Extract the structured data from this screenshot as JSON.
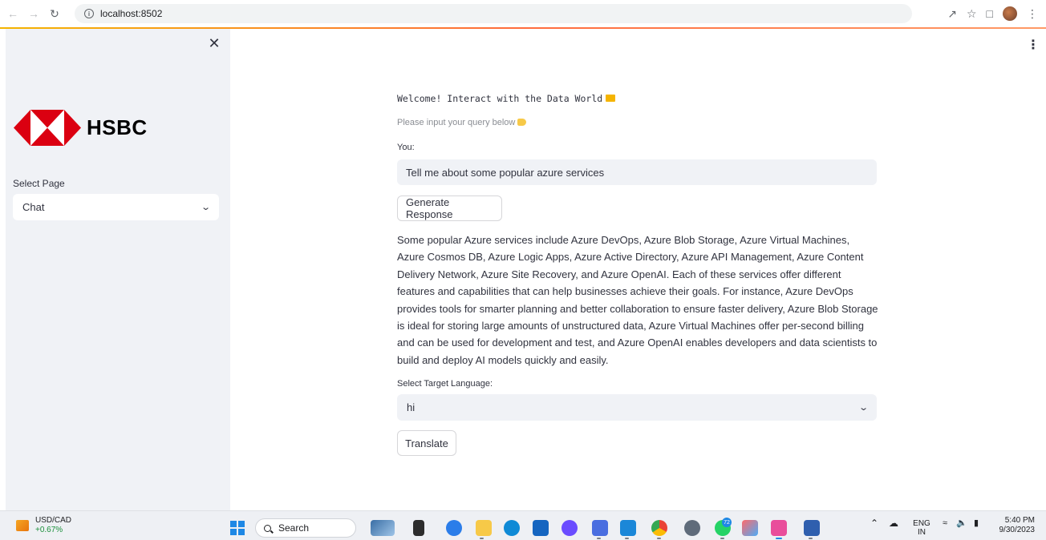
{
  "browser": {
    "url": "localhost:8502",
    "back_icon": "arrow-left-icon",
    "forward_icon": "arrow-right-icon",
    "reload_icon": "reload-icon"
  },
  "sidebar": {
    "logo_text": "HSBC",
    "select_label": "Select Page",
    "select_value": "Chat"
  },
  "main": {
    "welcome": "Welcome! Interact with the Data World",
    "hint": "Please input your query below",
    "you_label": "You:",
    "query_value": "Tell me about some popular azure services",
    "generate_button": "Generate Response",
    "response": "Some popular Azure services include Azure DevOps, Azure Blob Storage, Azure Virtual Machines, Azure Cosmos DB, Azure Logic Apps, Azure Active Directory, Azure API Management, Azure Content Delivery Network, Azure Site Recovery, and Azure OpenAI. Each of these services offer different features and capabilities that can help businesses achieve their goals. For instance, Azure DevOps provides tools for smarter planning and better collaboration to ensure faster delivery, Azure Blob Storage is ideal for storing large amounts of unstructured data, Azure Virtual Machines offer per-second billing and can be used for development and test, and Azure OpenAI enables developers and data scientists to build and deploy AI models quickly and easily.",
    "language_label": "Select Target Language:",
    "language_value": "hi",
    "translate_button": "Translate"
  },
  "taskbar": {
    "ticker_name": "USD/CAD",
    "ticker_change": "+0.67%",
    "search_placeholder": "Search",
    "whatsapp_badge": "72",
    "lang_top": "ENG",
    "lang_bottom": "IN",
    "time": "5:40 PM",
    "date": "9/30/2023"
  },
  "colors": {
    "hsbc_red": "#db0011",
    "sidebar_bg": "#f0f2f6",
    "accent_loading": "#ff6b3d"
  }
}
